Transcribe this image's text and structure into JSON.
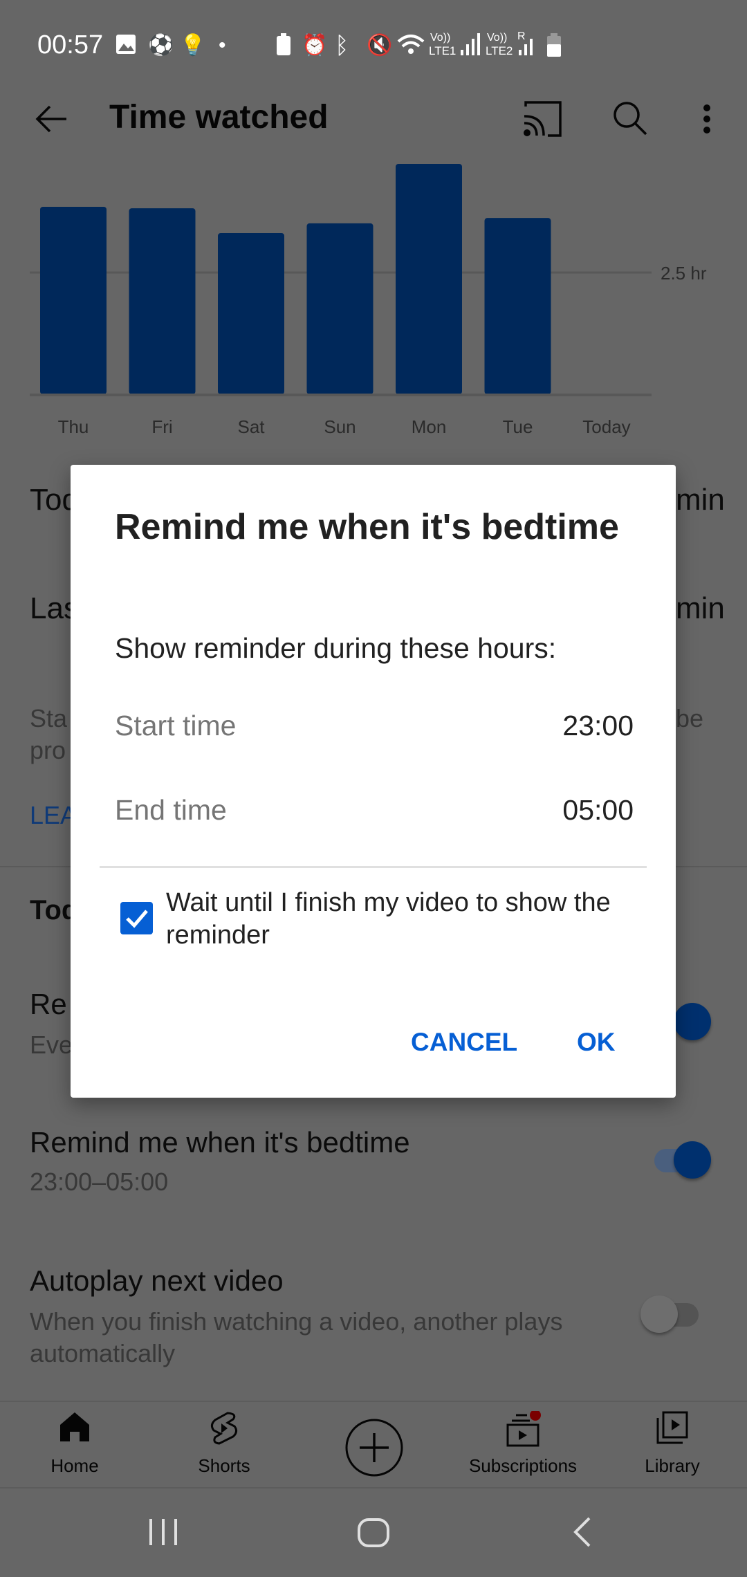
{
  "status_bar": {
    "time": "00:57",
    "lte1": "LTE1",
    "lte2": "LTE2",
    "volte": "Vo))",
    "roaming": "R"
  },
  "header": {
    "title": "Time watched",
    "icons": [
      "back-arrow-icon",
      "cast-icon",
      "search-icon",
      "more-vert-icon"
    ]
  },
  "chart_data": {
    "type": "bar",
    "categories": [
      "Thu",
      "Fri",
      "Sat",
      "Sun",
      "Mon",
      "Tue",
      "Today"
    ],
    "values": [
      3.85,
      3.82,
      3.31,
      3.51,
      4.73,
      3.62,
      0
    ],
    "gridline_label": "2.5 hr",
    "gridline_value": 2.5,
    "ylim": [
      0,
      5
    ],
    "bar_color": "#00285a",
    "grid": true
  },
  "background": {
    "today_label": "Tod",
    "today_value": "min",
    "last7_label": "Las",
    "last7_value": "min",
    "info_line1": "Sta",
    "info_line2": "pro",
    "info_tail": "be",
    "learn_more": "LEA",
    "tools_heading": "Tod",
    "remind_break_title": "Re",
    "remind_break_sub": "Eve",
    "bedtime_title": "Remind me when it's bedtime",
    "bedtime_sub": "23:00–05:00",
    "autoplay_title": "Autoplay next video",
    "autoplay_sub": "When you finish watching a video, another plays automatically",
    "toggles": {
      "remind_break": true,
      "bedtime": true,
      "autoplay": false
    }
  },
  "dialog": {
    "title": "Remind me when it's bedtime",
    "subtitle": "Show reminder during these hours:",
    "start_label": "Start time",
    "start_value": "23:00",
    "end_label": "End time",
    "end_value": "05:00",
    "checkbox_label": "Wait until I finish my video to show the reminder",
    "checkbox_checked": true,
    "cancel": "CANCEL",
    "ok": "OK",
    "accent": "#065fd4"
  },
  "bottom_nav": {
    "items": [
      {
        "label": "Home",
        "icon": "home-icon"
      },
      {
        "label": "Shorts",
        "icon": "shorts-icon"
      },
      {
        "label": "",
        "icon": "create-plus-icon"
      },
      {
        "label": "Subscriptions",
        "icon": "subscriptions-icon"
      },
      {
        "label": "Library",
        "icon": "library-icon"
      }
    ]
  },
  "system_nav": {
    "icons": [
      "recent-apps-icon",
      "home-circle-icon",
      "back-chevron-icon"
    ]
  }
}
